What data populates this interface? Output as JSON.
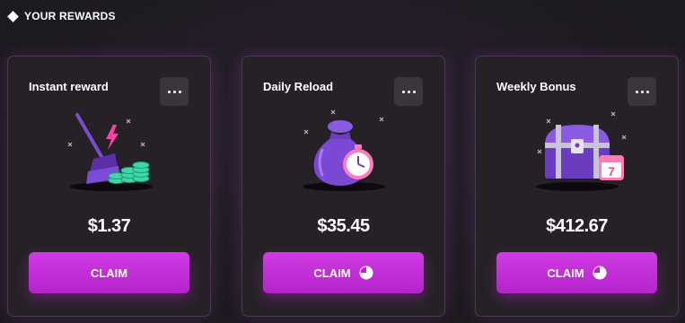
{
  "header": {
    "title": "YOUR REWARDS"
  },
  "cards": [
    {
      "title": "Instant reward",
      "amount": "$1.37",
      "claim_label": "CLAIM",
      "has_timer": false
    },
    {
      "title": "Daily Reload",
      "amount": "$35.45",
      "claim_label": "CLAIM",
      "has_timer": true
    },
    {
      "title": "Weekly Bonus",
      "amount": "$412.67",
      "claim_label": "CLAIM",
      "has_timer": true,
      "calendar_day": "7"
    }
  ],
  "colors": {
    "accent": "#c22fd9",
    "card_bg": "#252126",
    "page_bg": "#1f1c22"
  }
}
